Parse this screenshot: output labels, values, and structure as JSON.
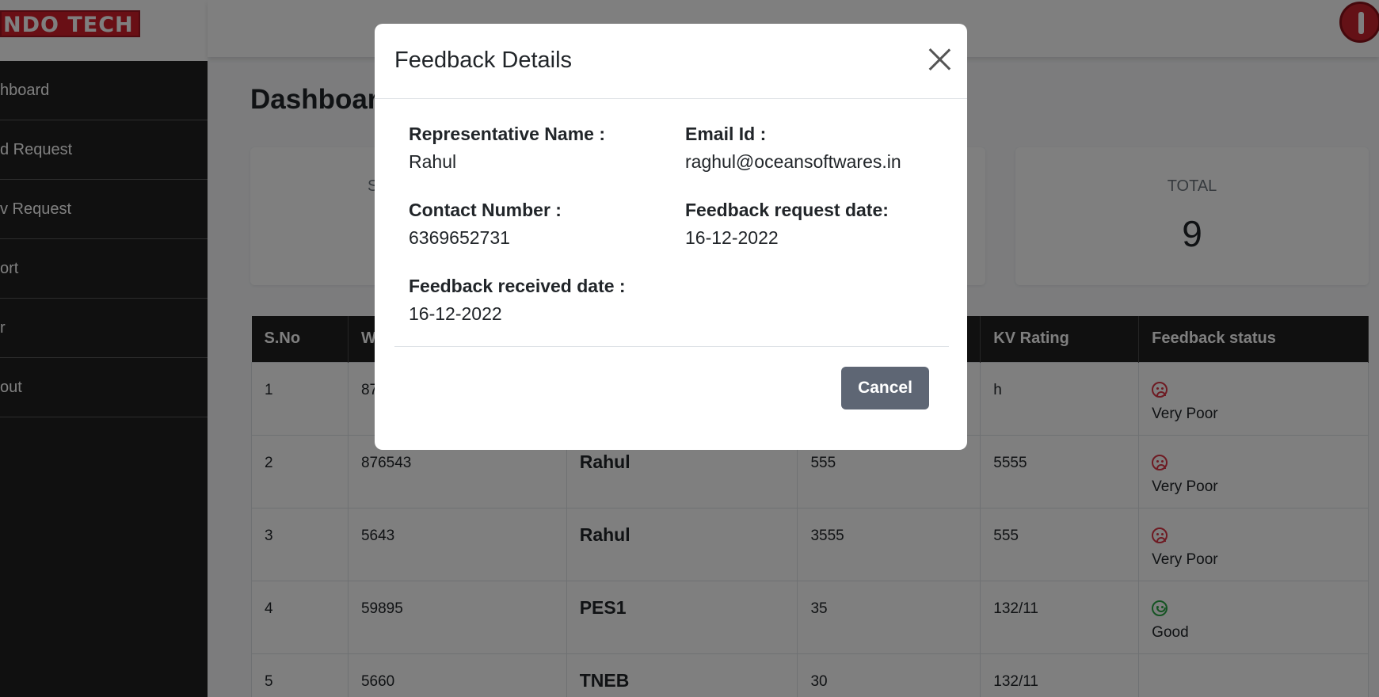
{
  "sidebar": {
    "logo_text": "NDO TECH",
    "items": [
      {
        "label": "hboard"
      },
      {
        "label": "d Request"
      },
      {
        "label": "v Request"
      },
      {
        "label": "ort"
      },
      {
        "label": "r"
      },
      {
        "label": "out"
      }
    ]
  },
  "main": {
    "title": "Dashboar",
    "cards": [
      {
        "label": "S",
        "value": ""
      },
      {
        "label": "",
        "value": ""
      },
      {
        "label": "TOTAL",
        "value": "9"
      }
    ]
  },
  "table": {
    "headers": [
      "S.No",
      "W",
      "",
      "",
      "KV Rating",
      "Feedback status"
    ],
    "rows": [
      {
        "sno": "1",
        "w": "87",
        "name": "",
        "val": "",
        "kv": "h",
        "status": "Very Poor",
        "face": "bad"
      },
      {
        "sno": "2",
        "w": "876543",
        "name": "Rahul",
        "val": "555",
        "kv": "5555",
        "status": "Very Poor",
        "face": "bad"
      },
      {
        "sno": "3",
        "w": "5643",
        "name": "Rahul",
        "val": "3555",
        "kv": "555",
        "status": "Very Poor",
        "face": "bad"
      },
      {
        "sno": "4",
        "w": "59895",
        "name": "PES1",
        "val": "35",
        "kv": "132/11",
        "status": "Good",
        "face": "good"
      },
      {
        "sno": "5",
        "w": "5660",
        "name": "TNEB",
        "val": "30",
        "kv": "132/11",
        "status": "",
        "face": ""
      }
    ]
  },
  "modal": {
    "title": "Feedback Details",
    "fields": {
      "rep_name_label": "Representative Name :",
      "rep_name_value": "Rahul",
      "email_label": "Email Id :",
      "email_value": "raghul@oceansoftwares.in",
      "contact_label": "Contact Number :",
      "contact_value": "6369652731",
      "request_date_label": "Feedback request date:",
      "request_date_value": "16-12-2022",
      "received_date_label": "Feedback received date :",
      "received_date_value": "16-12-2022"
    },
    "cancel_label": "Cancel"
  },
  "colors": {
    "sidebar_bg": "#212121",
    "logo_red": "#d21f2a",
    "cancel_bg": "#5e6674",
    "sad_face": "#dc3545",
    "happy_face": "#28a745"
  },
  "icons": {
    "close": "close-icon",
    "power": "power-icon",
    "sad": "sad-face-icon",
    "happy": "happy-face-icon"
  }
}
